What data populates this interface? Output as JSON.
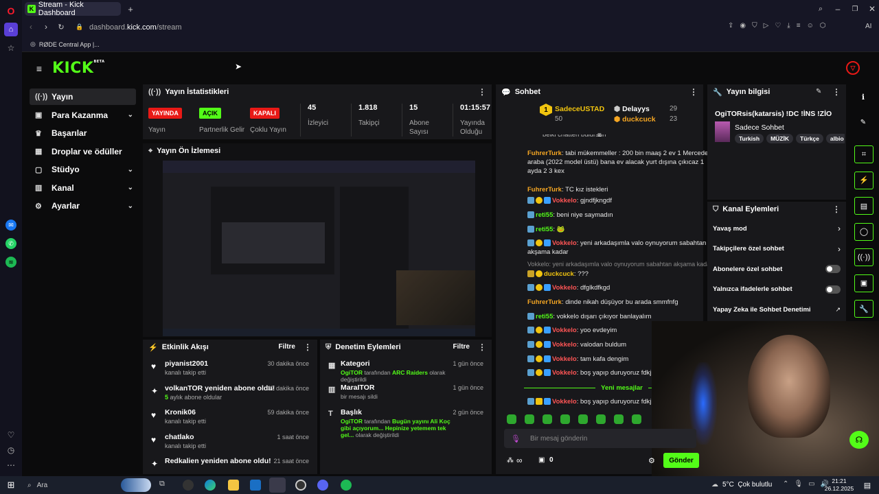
{
  "browser": {
    "tab_title": "Stream - Kick Dashboard",
    "new_tab": "+",
    "url_prefix": "dashboard.",
    "url_domain": "kick.com",
    "url_path": "/stream",
    "bookmark": "RØDE Central App |...",
    "ai_label": "AI"
  },
  "header": {
    "logo": "KICK",
    "beta": "BETA"
  },
  "sidebar": {
    "items": [
      {
        "label": "Yayın",
        "icon": "broadcast-icon"
      },
      {
        "label": "Para Kazanma",
        "icon": "money-icon"
      },
      {
        "label": "Başarılar",
        "icon": "trophy-icon"
      },
      {
        "label": "Droplar ve ödüller",
        "icon": "gift-icon"
      },
      {
        "label": "Stüdyo",
        "icon": "studio-icon"
      },
      {
        "label": "Kanal",
        "icon": "channel-icon"
      },
      {
        "label": "Ayarlar",
        "icon": "settings-icon"
      }
    ]
  },
  "stats": {
    "title": "Yayın İstatistikleri",
    "items": [
      {
        "badge": "YAYINDA",
        "label": "Yayın",
        "color": "#e91916"
      },
      {
        "badge": "AÇIK",
        "label": "Partnerlik Gelir",
        "color": "#53fc18"
      },
      {
        "badge": "KAPALI",
        "label": "Çoklu Yayın",
        "color": "#e91916"
      },
      {
        "value": "45",
        "label": "İzleyici"
      },
      {
        "value": "1.818",
        "label": "Takipçi"
      },
      {
        "value": "15",
        "label": "Abone Sayısı"
      },
      {
        "value": "01:15:57",
        "label": "Yayında Olduğu"
      }
    ]
  },
  "preview": {
    "title": "Yayın Ön İzlemesi"
  },
  "activity": {
    "title": "Etkinlik Akışı",
    "filter": "Filtre",
    "items": [
      {
        "title": "piyanist2001",
        "sub": "kanalı takip etti",
        "time": "30 dakika önce",
        "icon": "heart-icon"
      },
      {
        "title": "volkanTOR yeniden abone oldu!",
        "sub_num": "5",
        "sub": " aylık abone oldular",
        "time": "37 dakika önce",
        "icon": "star-icon"
      },
      {
        "title": "Kronik06",
        "sub": "kanalı takip etti",
        "time": "59 dakika önce",
        "icon": "heart-icon"
      },
      {
        "title": "chatlako",
        "sub": "kanalı takip etti",
        "time": "1 saat önce",
        "icon": "heart-icon"
      },
      {
        "title": "Redkalien yeniden abone oldu!",
        "sub": "",
        "time": "21 saat önce",
        "icon": "star-icon"
      }
    ]
  },
  "moderation": {
    "title": "Denetim Eylemleri",
    "filter": "Filtre",
    "items": [
      {
        "title": "Kategori",
        "time": "1 gün önce",
        "user": "OgiTOR",
        "mid": " tarafından ",
        "hl": "ARC Raiders",
        "rest": " olarak değiştirildi"
      },
      {
        "title": "MaraITOR",
        "time": "1 gün önce",
        "sub": "bir mesajı sildi"
      },
      {
        "title": "Başlık",
        "time": "2 gün önce",
        "user": "OgiTOR",
        "mid": " tarafından ",
        "hl": "Bugün yayını Ali Koç gibi açıyorum... Hepinize yetemem tek gel...",
        "rest": " olarak değiştirildi"
      }
    ]
  },
  "chat": {
    "title": "Sohbet",
    "top": [
      {
        "rank": "1",
        "name": "SadeceUSTAD",
        "count": "50"
      },
      {
        "name": "Delayys",
        "count": "29"
      },
      {
        "name": "duckcuck",
        "count": "23"
      }
    ],
    "partial_top": "beiki chatten buldrsun",
    "messages": [
      {
        "user": "FuhrerTurk",
        "color": "u-orange",
        "text": ": tabi mükemmeller : 200 bin maaş 2 ev 1 Mercedes araba (2022 model üstü) bana ev alacak yurt dışına çıkıcaz 1 ayda 2 3 kex",
        "badges": 0
      },
      {
        "user": "FuhrerTurk",
        "color": "u-orange",
        "text": ": TC kız istekleri",
        "badges": 0
      },
      {
        "user": "Vokkelo",
        "color": "u-red",
        "text": ": gjndfjkngdf",
        "badges": 3
      },
      {
        "user": "reti55",
        "color": "u-green",
        "text": ": beni niye saymadın",
        "badges": 1
      },
      {
        "user": "reti55",
        "color": "u-green",
        "text": ": 🐸",
        "badges": 1
      },
      {
        "user": "Vokkelo",
        "color": "u-red",
        "text": ": yeni arkadaşımla valo oynuyorum sabahtan akşama kadar",
        "badges": 3
      },
      {
        "reply": "Vokkelo: yeni arkadaşımla valo oynuyorum sabahtan akşama kadar ..."
      },
      {
        "user": "duckcuck",
        "color": "u-yellow",
        "text": ": ???",
        "badges": 2
      },
      {
        "user": "Vokkelo",
        "color": "u-red",
        "text": ": dfglkdfkgd",
        "badges": 3
      },
      {
        "user": "FuhrerTurk",
        "color": "u-orange",
        "text": ": dinde nikah düşüyor bu arada smmfnfg",
        "badges": 0
      },
      {
        "user": "reti55",
        "color": "u-green",
        "text": ": vokkelo dışarı çıkıyor banlayalım",
        "badges": 1
      },
      {
        "user": "Vokkelo",
        "color": "u-red",
        "text": ": yoo evdeyim",
        "badges": 3
      },
      {
        "user": "Vokkelo",
        "color": "u-red",
        "text": ": valodan buldum",
        "badges": 3
      },
      {
        "user": "Vokkelo",
        "color": "u-red",
        "text": ": tam kafa dengim",
        "badges": 3
      },
      {
        "user": "Vokkelo",
        "color": "u-red",
        "text": ": boş yapıp duruyoruz fdkjngjkdfn",
        "badges": 3
      }
    ],
    "new_messages": "Yeni mesajlar",
    "last": {
      "user": "Vokkelo",
      "text": ": boş yapıp duruyoruz fdkjngjkdfn"
    },
    "input_placeholder": "Bir mesaj gönderin",
    "send": "Gönder",
    "viewers_icon": "∞",
    "count": "0"
  },
  "streaminfo": {
    "title": "Yayın bilgisi",
    "stream_title": "OgiTORsis(katarsis) !DC !İNS !ZİO",
    "category": "Sadece Sohbet",
    "tags": [
      "Turkish",
      "MÜZİK",
      "Türkçe",
      "albio"
    ]
  },
  "channel_actions": {
    "title": "Kanal Eylemleri",
    "items": [
      {
        "label": "Yavaş mod",
        "type": "chevron"
      },
      {
        "label": "Takipçilere özel sohbet",
        "type": "chevron"
      },
      {
        "label": "Abonelere özel sohbet",
        "type": "toggle"
      },
      {
        "label": "Yalnızca ifadelerle sohbet",
        "type": "toggle"
      },
      {
        "label": "Yapay Zeka ile Sohbet Denetimi",
        "type": "external"
      }
    ]
  },
  "taskbar": {
    "search": "Ara",
    "weather": "5°C  Çok bulutlu",
    "time": "21:21",
    "date": "26.12.2025"
  },
  "colors": {
    "kick_green": "#53fc18",
    "live_red": "#e91916",
    "panel": "#18181b"
  }
}
